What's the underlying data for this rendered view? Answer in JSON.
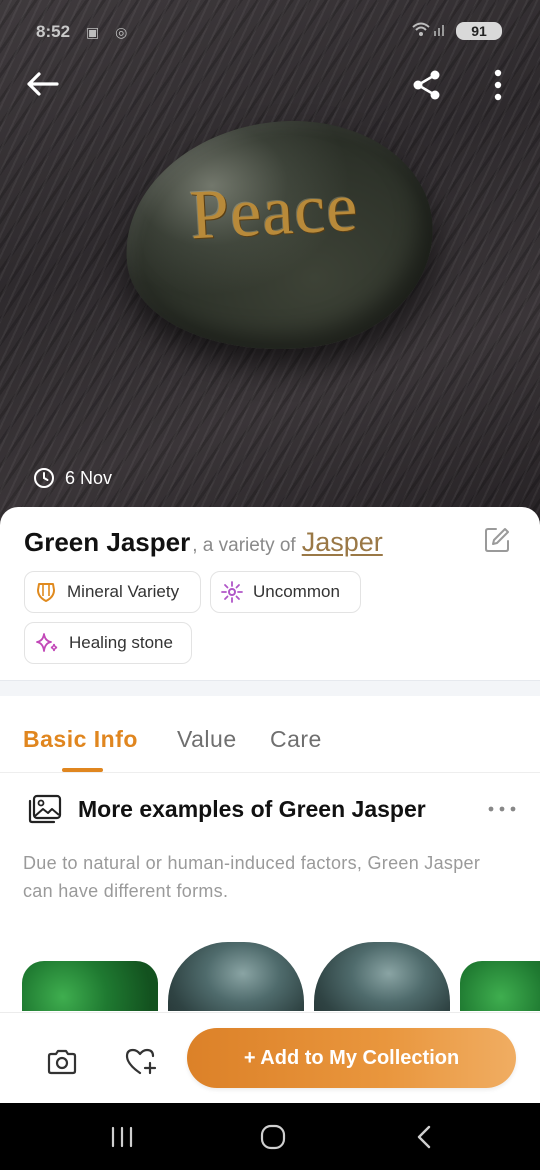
{
  "status_bar": {
    "time": "8:52",
    "left_icons": "▣ ◎",
    "battery": "91"
  },
  "hero": {
    "stone_text": "Peace",
    "date": "6 Nov"
  },
  "specimen": {
    "name": "Green Jasper",
    "variety_prefix": ", a variety of",
    "parent": "Jasper"
  },
  "tags": [
    {
      "label": "Mineral Variety",
      "icon": "gem-shield-icon",
      "color": "#e08a1e"
    },
    {
      "label": "Uncommon",
      "icon": "sparkle-burst-icon",
      "color": "#b056c8"
    },
    {
      "label": "Healing stone",
      "icon": "sparkles-icon",
      "color": "#c248b8"
    }
  ],
  "tabs": [
    {
      "label": "Basic Info",
      "active": true
    },
    {
      "label": "Value",
      "active": false
    },
    {
      "label": "Care",
      "active": false
    }
  ],
  "section": {
    "title": "More examples of Green Jasper",
    "description": "Due to natural or human-induced factors, Green Jasper can have different forms."
  },
  "actions": {
    "add_label": "+ Add to My Collection"
  },
  "colors": {
    "accent": "#e0861f",
    "link": "#9a7846"
  }
}
